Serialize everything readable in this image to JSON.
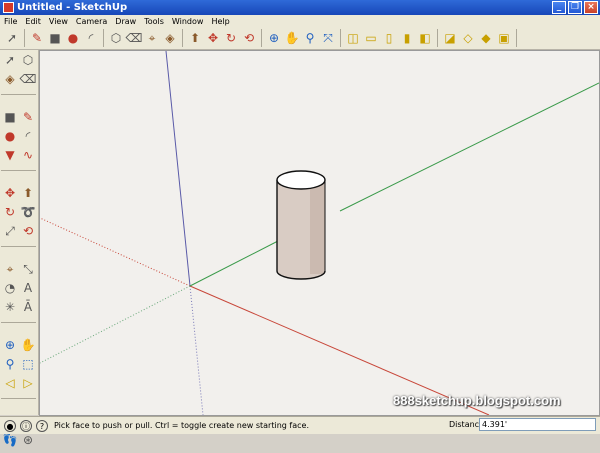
{
  "window": {
    "title": "Untitled - SketchUp",
    "controls": [
      "_",
      "❐",
      "×"
    ]
  },
  "menu": [
    "File",
    "Edit",
    "View",
    "Camera",
    "Draw",
    "Tools",
    "Window",
    "Help"
  ],
  "toolbar_groups": [
    [
      {
        "name": "select-icon",
        "glyph": "➚"
      }
    ],
    [
      {
        "name": "pencil-icon",
        "glyph": "✎"
      },
      {
        "name": "rectangle-icon",
        "glyph": "■"
      },
      {
        "name": "circle-icon",
        "glyph": "●"
      },
      {
        "name": "arc-icon",
        "glyph": "◜"
      }
    ],
    [
      {
        "name": "make-component-icon",
        "glyph": "⬡"
      },
      {
        "name": "eraser-icon",
        "glyph": "⌫"
      },
      {
        "name": "tape-measure-icon",
        "glyph": "⌖"
      },
      {
        "name": "paint-bucket-icon",
        "glyph": "◈"
      }
    ],
    [
      {
        "name": "push-pull-icon",
        "glyph": "⬆"
      },
      {
        "name": "move-icon",
        "glyph": "✥"
      },
      {
        "name": "rotate-icon",
        "glyph": "↻"
      },
      {
        "name": "offset-icon",
        "glyph": "⟲"
      }
    ],
    [
      {
        "name": "orbit-icon",
        "glyph": "⊕"
      },
      {
        "name": "pan-icon",
        "glyph": "✋"
      },
      {
        "name": "zoom-icon",
        "glyph": "⚲"
      },
      {
        "name": "zoom-extents-icon",
        "glyph": "⤧"
      }
    ],
    [
      {
        "name": "iso-view-icon",
        "glyph": "◫"
      },
      {
        "name": "top-view-icon",
        "glyph": "▭"
      },
      {
        "name": "front-view-icon",
        "glyph": "▯"
      },
      {
        "name": "right-view-icon",
        "glyph": "▮"
      },
      {
        "name": "back-view-icon",
        "glyph": "◧"
      }
    ],
    [
      {
        "name": "xray-style-icon",
        "glyph": "◪"
      },
      {
        "name": "wireframe-style-icon",
        "glyph": "◇"
      },
      {
        "name": "shaded-style-icon",
        "glyph": "◆"
      },
      {
        "name": "textured-style-icon",
        "glyph": "▣"
      }
    ]
  ],
  "side_tools": [
    {
      "name": "select-icon",
      "glyph": "➚"
    },
    {
      "name": "make-component-icon",
      "glyph": "⬡"
    },
    {
      "name": "paint-bucket-icon",
      "glyph": "◈"
    },
    {
      "name": "eraser-icon",
      "glyph": "⌫"
    },
    {
      "sep": true
    },
    {
      "name": "rectangle-icon",
      "glyph": "■"
    },
    {
      "name": "line-icon",
      "glyph": "✎"
    },
    {
      "name": "circle-icon",
      "glyph": "●"
    },
    {
      "name": "arc-icon",
      "glyph": "◜"
    },
    {
      "name": "polygon-icon",
      "glyph": "▼"
    },
    {
      "name": "freehand-icon",
      "glyph": "∿"
    },
    {
      "sep": true
    },
    {
      "name": "move-icon",
      "glyph": "✥"
    },
    {
      "name": "push-pull-icon",
      "glyph": "⬆"
    },
    {
      "name": "rotate-icon",
      "glyph": "↻"
    },
    {
      "name": "follow-me-icon",
      "glyph": "➰"
    },
    {
      "name": "scale-icon",
      "glyph": "⤢"
    },
    {
      "name": "offset-icon",
      "glyph": "⟲"
    },
    {
      "sep": true
    },
    {
      "name": "tape-measure-icon",
      "glyph": "⌖"
    },
    {
      "name": "dimension-icon",
      "glyph": "⤡"
    },
    {
      "name": "protractor-icon",
      "glyph": "◔"
    },
    {
      "name": "text-icon",
      "glyph": "A"
    },
    {
      "name": "axes-icon",
      "glyph": "✳"
    },
    {
      "name": "3d-text-icon",
      "glyph": "Ā"
    },
    {
      "sep": true
    },
    {
      "name": "orbit-icon",
      "glyph": "⊕"
    },
    {
      "name": "pan-icon",
      "glyph": "✋"
    },
    {
      "name": "zoom-icon",
      "glyph": "⚲"
    },
    {
      "name": "zoom-window-icon",
      "glyph": "⬚"
    },
    {
      "name": "previous-view-icon",
      "glyph": "◁"
    },
    {
      "name": "next-view-icon",
      "glyph": "▷"
    },
    {
      "sep": true
    },
    {
      "name": "position-camera-icon",
      "glyph": "♀"
    },
    {
      "name": "look-around-icon",
      "glyph": "◉"
    },
    {
      "name": "walk-icon",
      "glyph": "👣"
    },
    {
      "name": "section-plane-icon",
      "glyph": "⊛"
    }
  ],
  "status": {
    "icons": [
      "i-icon",
      "info-icon",
      "help-icon"
    ],
    "message": "Pick face to push or pull.  Ctrl = toggle create new starting face.",
    "distance_label": "Distance",
    "distance_value": "4.391'"
  },
  "watermark": "888sketchup.blogspot.com",
  "colors": {
    "red_axis": "#c8473a",
    "green_axis": "#3a9a4a",
    "blue_axis": "#5a5aa8",
    "cylinder_face": "#d9ccc4"
  }
}
